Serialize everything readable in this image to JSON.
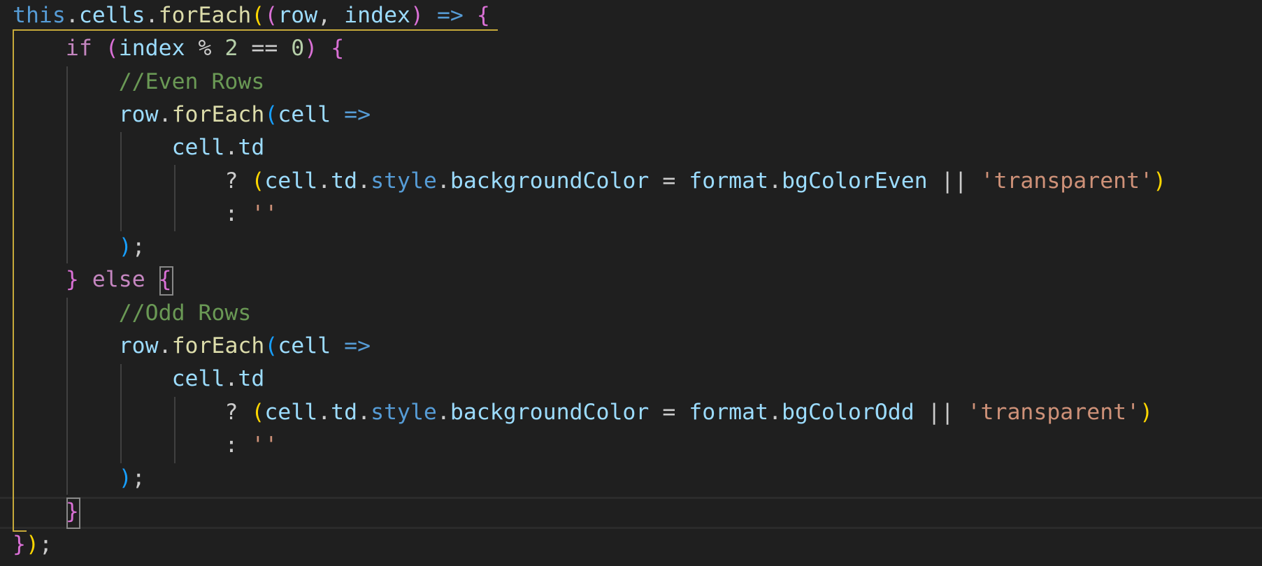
{
  "theme": {
    "background": "#1f1f1f",
    "default_text": "#cccccc",
    "keyword_control": "#c586c0",
    "keyword_storage": "#569cd6",
    "variable": "#9cdcfe",
    "function": "#dcdcaa",
    "number": "#b5cea8",
    "string": "#ce9178",
    "comment": "#6a9955",
    "bracket_level_1": "#ffd700",
    "bracket_level_2": "#da70d6",
    "bracket_level_3": "#179fff",
    "scope_highlight": "#c6a93a",
    "bracket_match_border": "#888888"
  },
  "code": {
    "language": "javascript",
    "lines": [
      {
        "tokens": [
          {
            "t": "this",
            "k": "storage"
          },
          {
            "t": ".",
            "k": "default"
          },
          {
            "t": "cells",
            "k": "variable"
          },
          {
            "t": ".",
            "k": "default"
          },
          {
            "t": "forEach",
            "k": "function"
          },
          {
            "t": "(",
            "k": "bracket1"
          },
          {
            "t": "(",
            "k": "bracket2"
          },
          {
            "t": "row",
            "k": "variable"
          },
          {
            "t": ", ",
            "k": "default"
          },
          {
            "t": "index",
            "k": "variable"
          },
          {
            "t": ")",
            "k": "bracket2"
          },
          {
            "t": " ",
            "k": "default"
          },
          {
            "t": "=>",
            "k": "storage"
          },
          {
            "t": " ",
            "k": "default"
          },
          {
            "t": "{",
            "k": "bracket2"
          }
        ]
      },
      {
        "tokens": [
          {
            "t": "    ",
            "k": "default"
          },
          {
            "t": "if",
            "k": "control"
          },
          {
            "t": " ",
            "k": "default"
          },
          {
            "t": "(",
            "k": "bracket3"
          },
          {
            "t": "index",
            "k": "variable"
          },
          {
            "t": " % ",
            "k": "default"
          },
          {
            "t": "2",
            "k": "number"
          },
          {
            "t": " == ",
            "k": "default"
          },
          {
            "t": "0",
            "k": "number"
          },
          {
            "t": ")",
            "k": "bracket3"
          },
          {
            "t": " ",
            "k": "default"
          },
          {
            "t": "{",
            "k": "bracket3"
          }
        ]
      },
      {
        "tokens": [
          {
            "t": "        ",
            "k": "default"
          },
          {
            "t": "//Even Rows",
            "k": "comment"
          }
        ]
      },
      {
        "tokens": [
          {
            "t": "        ",
            "k": "default"
          },
          {
            "t": "row",
            "k": "variable"
          },
          {
            "t": ".",
            "k": "default"
          },
          {
            "t": "forEach",
            "k": "function"
          },
          {
            "t": "(",
            "k": "bracket3b"
          },
          {
            "t": "cell",
            "k": "variable"
          },
          {
            "t": " ",
            "k": "default"
          },
          {
            "t": "=>",
            "k": "storage"
          }
        ]
      },
      {
        "tokens": [
          {
            "t": "            ",
            "k": "default"
          },
          {
            "t": "cell",
            "k": "variable"
          },
          {
            "t": ".",
            "k": "default"
          },
          {
            "t": "td",
            "k": "variable"
          }
        ]
      },
      {
        "tokens": [
          {
            "t": "                ",
            "k": "default"
          },
          {
            "t": "? ",
            "k": "default"
          },
          {
            "t": "(",
            "k": "bracket1"
          },
          {
            "t": "cell",
            "k": "variable"
          },
          {
            "t": ".",
            "k": "default"
          },
          {
            "t": "td",
            "k": "variable"
          },
          {
            "t": ".",
            "k": "default"
          },
          {
            "t": "style",
            "k": "storage"
          },
          {
            "t": ".",
            "k": "default"
          },
          {
            "t": "backgroundColor",
            "k": "variable"
          },
          {
            "t": " = ",
            "k": "default"
          },
          {
            "t": "format",
            "k": "variable"
          },
          {
            "t": ".",
            "k": "default"
          },
          {
            "t": "bgColorEven",
            "k": "variable"
          },
          {
            "t": " || ",
            "k": "default"
          },
          {
            "t": "'transparent'",
            "k": "string"
          },
          {
            "t": ")",
            "k": "bracket1"
          }
        ]
      },
      {
        "tokens": [
          {
            "t": "                ",
            "k": "default"
          },
          {
            "t": ": ",
            "k": "default"
          },
          {
            "t": "''",
            "k": "string"
          }
        ]
      },
      {
        "tokens": [
          {
            "t": "        ",
            "k": "default"
          },
          {
            "t": ")",
            "k": "bracket3b"
          },
          {
            "t": ";",
            "k": "default"
          }
        ]
      },
      {
        "tokens": [
          {
            "t": "    ",
            "k": "default"
          },
          {
            "t": "}",
            "k": "bracket3"
          },
          {
            "t": " ",
            "k": "default"
          },
          {
            "t": "else",
            "k": "control"
          },
          {
            "t": " ",
            "k": "default"
          },
          {
            "t": "{",
            "k": "bracket3"
          }
        ]
      },
      {
        "tokens": [
          {
            "t": "        ",
            "k": "default"
          },
          {
            "t": "//Odd Rows",
            "k": "comment"
          }
        ]
      },
      {
        "tokens": [
          {
            "t": "        ",
            "k": "default"
          },
          {
            "t": "row",
            "k": "variable"
          },
          {
            "t": ".",
            "k": "default"
          },
          {
            "t": "forEach",
            "k": "function"
          },
          {
            "t": "(",
            "k": "bracket3b"
          },
          {
            "t": "cell",
            "k": "variable"
          },
          {
            "t": " ",
            "k": "default"
          },
          {
            "t": "=>",
            "k": "storage"
          }
        ]
      },
      {
        "tokens": [
          {
            "t": "            ",
            "k": "default"
          },
          {
            "t": "cell",
            "k": "variable"
          },
          {
            "t": ".",
            "k": "default"
          },
          {
            "t": "td",
            "k": "variable"
          }
        ]
      },
      {
        "tokens": [
          {
            "t": "                ",
            "k": "default"
          },
          {
            "t": "? ",
            "k": "default"
          },
          {
            "t": "(",
            "k": "bracket1"
          },
          {
            "t": "cell",
            "k": "variable"
          },
          {
            "t": ".",
            "k": "default"
          },
          {
            "t": "td",
            "k": "variable"
          },
          {
            "t": ".",
            "k": "default"
          },
          {
            "t": "style",
            "k": "storage"
          },
          {
            "t": ".",
            "k": "default"
          },
          {
            "t": "backgroundColor",
            "k": "variable"
          },
          {
            "t": " = ",
            "k": "default"
          },
          {
            "t": "format",
            "k": "variable"
          },
          {
            "t": ".",
            "k": "default"
          },
          {
            "t": "bgColorOdd",
            "k": "variable"
          },
          {
            "t": " || ",
            "k": "default"
          },
          {
            "t": "'transparent'",
            "k": "string"
          },
          {
            "t": ")",
            "k": "bracket1"
          }
        ]
      },
      {
        "tokens": [
          {
            "t": "                ",
            "k": "default"
          },
          {
            "t": ": ",
            "k": "default"
          },
          {
            "t": "''",
            "k": "string"
          }
        ]
      },
      {
        "tokens": [
          {
            "t": "        ",
            "k": "default"
          },
          {
            "t": ")",
            "k": "bracket3b"
          },
          {
            "t": ";",
            "k": "default"
          }
        ]
      },
      {
        "tokens": [
          {
            "t": "    ",
            "k": "default"
          },
          {
            "t": "}",
            "k": "bracket3"
          }
        ]
      },
      {
        "tokens": [
          {
            "t": "}",
            "k": "bracket2"
          },
          {
            "t": ")",
            "k": "bracket1"
          },
          {
            "t": ";",
            "k": "default"
          }
        ]
      }
    ]
  }
}
